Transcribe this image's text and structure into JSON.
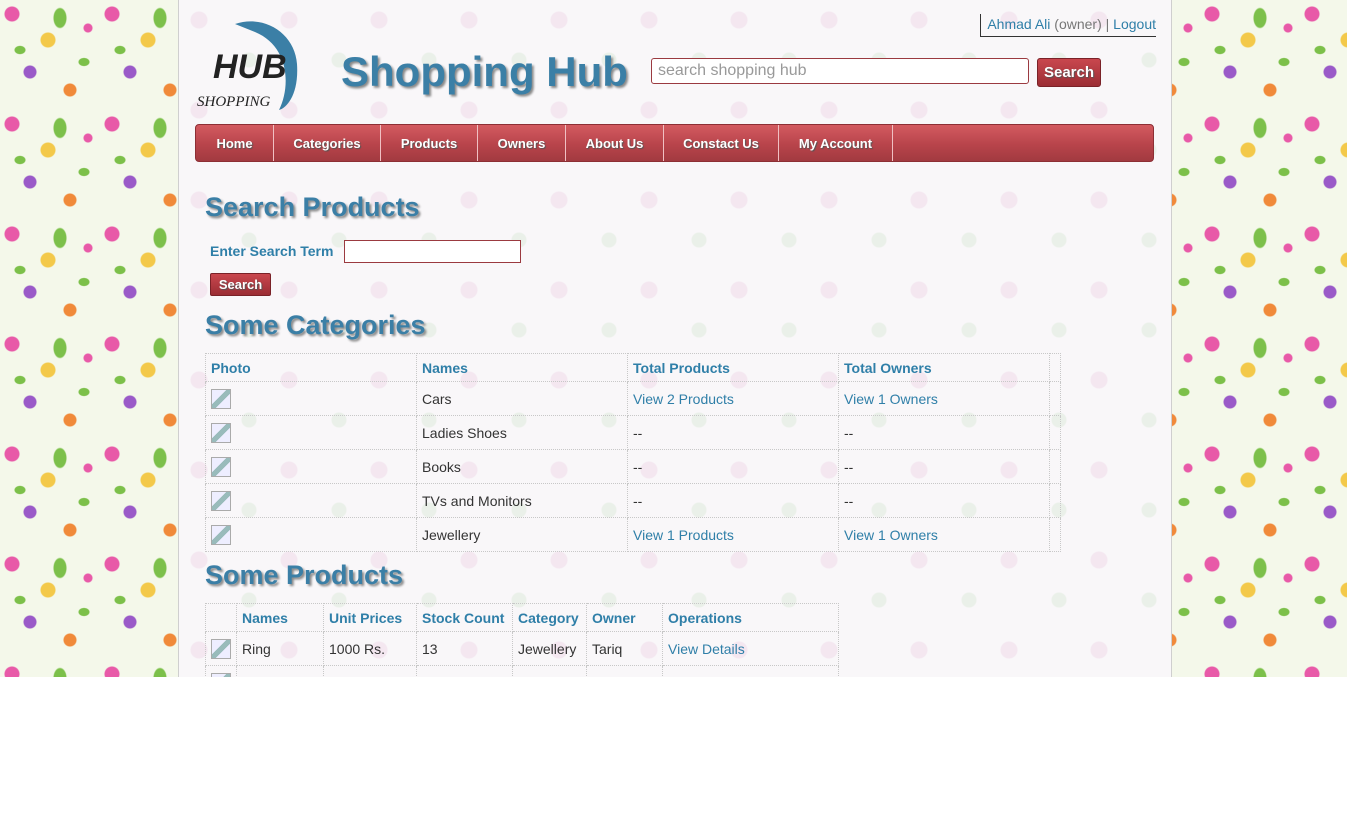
{
  "header": {
    "logo_text": "HUB",
    "logo_subtext": "SHOPPING",
    "site_title": "Shopping Hub",
    "user_name": "Ahmad Ali",
    "user_role": "(owner)",
    "separator": "|",
    "logout_label": "Logout",
    "search_placeholder": "search shopping hub",
    "search_button": "Search"
  },
  "nav": {
    "items": [
      "Home",
      "Categories",
      "Products",
      "Owners",
      "About Us",
      "Constact Us",
      "My Account"
    ]
  },
  "search_section": {
    "title": "Search Products",
    "label": "Enter Search Term",
    "input_value": "",
    "button": "Search"
  },
  "categories_section": {
    "title": "Some Categories",
    "columns": [
      "Photo",
      "Names",
      "Total Products",
      "Total Owners"
    ],
    "rows": [
      {
        "name": "Cars",
        "products": "View 2 Products",
        "owners": "View 1 Owners"
      },
      {
        "name": "Ladies Shoes",
        "products": "--",
        "owners": "--"
      },
      {
        "name": "Books",
        "products": "--",
        "owners": "--"
      },
      {
        "name": "TVs and Monitors",
        "products": "--",
        "owners": "--"
      },
      {
        "name": "Jewellery",
        "products": "View 1 Products",
        "owners": "View 1 Owners"
      }
    ]
  },
  "products_section": {
    "title": "Some Products",
    "columns": [
      "",
      "Names",
      "Unit Prices",
      "Stock Count",
      "Category",
      "Owner",
      "Operations"
    ],
    "rows": [
      {
        "name": "Ring",
        "price": "1000 Rs.",
        "stock": "13",
        "category": "Jewellery",
        "owner": "Tariq",
        "operation": "View Details"
      }
    ]
  },
  "colors": {
    "accent_blue": "#3b7fa6",
    "brand_red": "#b8444b"
  }
}
